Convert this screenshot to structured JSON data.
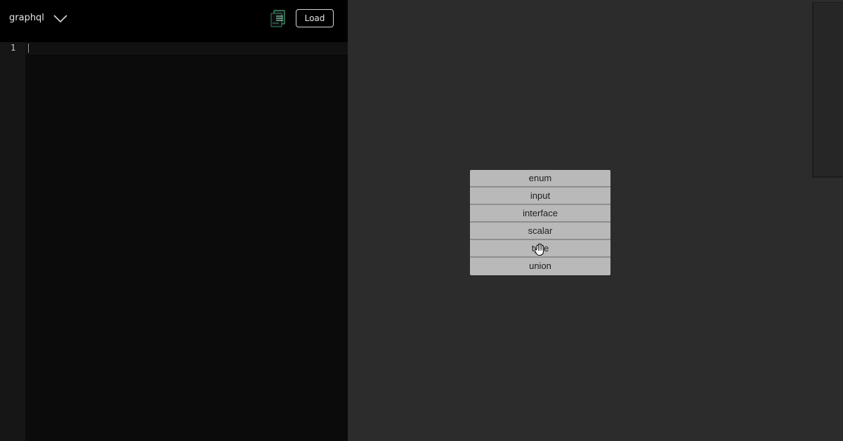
{
  "toolbar": {
    "language_label": "graphql",
    "language_dropdown_icon": "chevron-down-icon",
    "copy_icon": "copy-document-icon",
    "load_label": "Load"
  },
  "editor": {
    "line_numbers": [
      "1"
    ],
    "content": ""
  },
  "type_menu": {
    "items": [
      "enum",
      "input",
      "interface",
      "scalar",
      "type",
      "union"
    ],
    "hovered_index": 4
  },
  "cursor": {
    "icon": "grab-hand-cursor-icon"
  },
  "colors": {
    "editor_bg": "#0b0b0b",
    "toolbar_bg": "#000000",
    "canvas_bg": "#2c2c2c",
    "menu_bg": "#b9b9b9",
    "copy_icon_accent": "#3f8f6a"
  }
}
